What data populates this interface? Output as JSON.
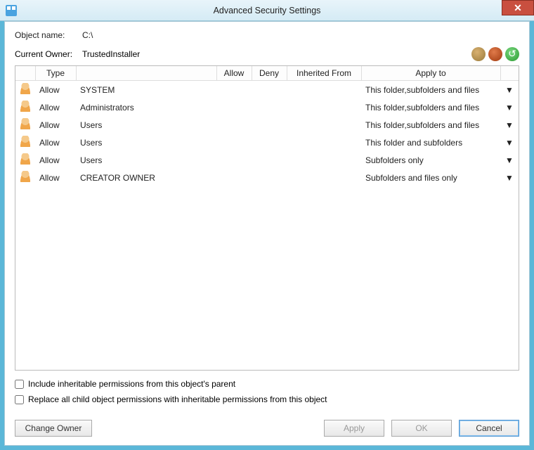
{
  "window": {
    "title": "Advanced Security Settings"
  },
  "labels": {
    "objectName": "Object name:",
    "objectValue": "C:\\",
    "currentOwner": "Current Owner:",
    "ownerValue": "TrustedInstaller"
  },
  "columns": {
    "type": "Type",
    "principal": "",
    "allow": "Allow",
    "deny": "Deny",
    "inherited": "Inherited From",
    "applyTo": "Apply to"
  },
  "rows": [
    {
      "type": "Allow",
      "principal": "SYSTEM",
      "allow": "",
      "deny": "",
      "inherited": "",
      "applyTo": "This folder,subfolders and files"
    },
    {
      "type": "Allow",
      "principal": "Administrators",
      "allow": "",
      "deny": "",
      "inherited": "",
      "applyTo": "This folder,subfolders and files"
    },
    {
      "type": "Allow",
      "principal": "Users",
      "allow": "",
      "deny": "",
      "inherited": "",
      "applyTo": "This folder,subfolders and files"
    },
    {
      "type": "Allow",
      "principal": "Users",
      "allow": "",
      "deny": "",
      "inherited": "",
      "applyTo": "This folder and subfolders"
    },
    {
      "type": "Allow",
      "principal": "Users",
      "allow": "",
      "deny": "",
      "inherited": "",
      "applyTo": "Subfolders only"
    },
    {
      "type": "Allow",
      "principal": "CREATOR OWNER",
      "allow": "",
      "deny": "",
      "inherited": "",
      "applyTo": "Subfolders and files only"
    }
  ],
  "checkboxes": {
    "inherit": "Include inheritable permissions from this object's parent",
    "replace": "Replace all child object permissions with inheritable permissions from this object"
  },
  "buttons": {
    "changeOwner": "Change Owner",
    "apply": "Apply",
    "ok": "OK",
    "cancel": "Cancel"
  }
}
